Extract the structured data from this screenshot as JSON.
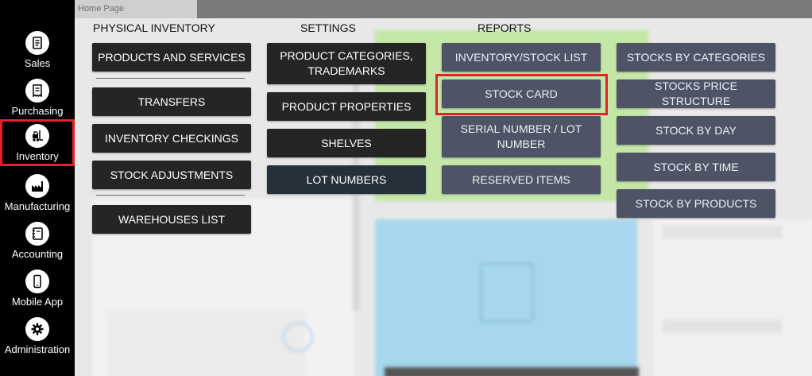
{
  "window": {
    "tab_title": "Home Page"
  },
  "sidebar": {
    "items": [
      {
        "label": "Sales",
        "icon": "document-icon"
      },
      {
        "label": "Purchasing",
        "icon": "receipt-icon"
      },
      {
        "label": "Inventory",
        "icon": "forklift-icon",
        "active": true
      },
      {
        "label": "Manufacturing",
        "icon": "factory-icon"
      },
      {
        "label": "Accounting",
        "icon": "ledger-icon"
      },
      {
        "label": "Mobile App",
        "icon": "smartphone-icon"
      },
      {
        "label": "Administration",
        "icon": "gear-icon"
      }
    ]
  },
  "menu": {
    "physical_inventory": {
      "title": "PHYSICAL INVENTORY",
      "items": [
        "PRODUCTS AND SERVICES",
        "TRANSFERS",
        "INVENTORY CHECKINGS",
        "STOCK ADJUSTMENTS",
        "WAREHOUSES LIST"
      ]
    },
    "settings": {
      "title": "SETTINGS",
      "items": [
        "PRODUCT CATEGORIES, TRADEMARKS",
        "PRODUCT PROPERTIES",
        "SHELVES",
        "LOT NUMBERS"
      ]
    },
    "reports": {
      "title": "REPORTS",
      "items": [
        "INVENTORY/STOCK LIST",
        "STOCK CARD",
        "SERIAL NUMBER / LOT NUMBER",
        "RESERVED ITEMS"
      ],
      "items_right": [
        "STOCKS BY CATEGORIES",
        "STOCKS PRICE STRUCTURE",
        "STOCK BY DAY",
        "STOCK BY TIME",
        "STOCK BY PRODUCTS"
      ],
      "highlighted": "STOCK CARD"
    }
  },
  "colors": {
    "sidebar_bg": "#000000",
    "highlight": "#e5202a",
    "button_dark": "#252525",
    "button_slate": "#4e5466"
  }
}
